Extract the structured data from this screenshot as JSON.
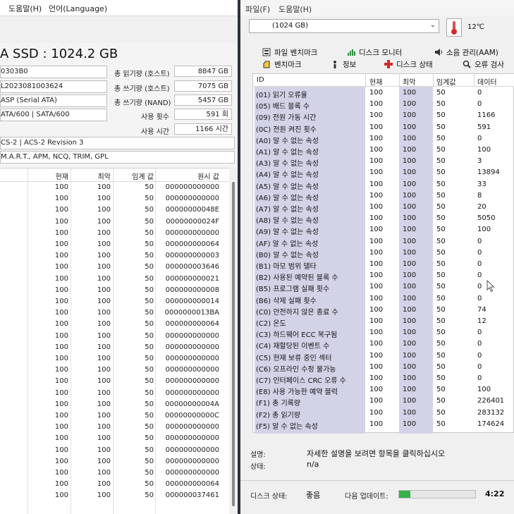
{
  "left": {
    "menu": [
      "도움말(H)",
      "언어(Language)"
    ],
    "title": "A SSD : 1024.2 GB",
    "fields": [
      {
        "value": "0303B0"
      },
      {
        "value": "L2023081003624"
      },
      {
        "value": "ASP (Serial ATA)"
      },
      {
        "value": "ATA/600 | SATA/600"
      }
    ],
    "stats": [
      {
        "label": "총 읽기량 (호스트)",
        "value": "8847 GB"
      },
      {
        "label": "총 쓰기량 (호스트)",
        "value": "7075 GB"
      },
      {
        "label": "총 쓰기량 (NAND)",
        "value": "5457 GB"
      },
      {
        "label": "사용 횟수",
        "value": "591 회"
      },
      {
        "label": "사용 시간",
        "value": "1166 시간"
      }
    ],
    "standard": "CS-2 | ACS-2 Revision 3",
    "features": "M.A.R.T., APM, NCQ, TRIM, GPL",
    "columns": [
      "현재",
      "최악",
      "임계 값",
      "원시 값"
    ],
    "rows": [
      [
        "100",
        "100",
        "50",
        "000000000000"
      ],
      [
        "100",
        "100",
        "50",
        "000000000000"
      ],
      [
        "100",
        "100",
        "50",
        "00000000048E"
      ],
      [
        "100",
        "100",
        "50",
        "00000000024F"
      ],
      [
        "100",
        "100",
        "50",
        "000000000000"
      ],
      [
        "100",
        "100",
        "50",
        "000000000064"
      ],
      [
        "100",
        "100",
        "50",
        "000000000003"
      ],
      [
        "100",
        "100",
        "50",
        "000000003646"
      ],
      [
        "100",
        "100",
        "50",
        "000000000021"
      ],
      [
        "100",
        "100",
        "50",
        "000000000008"
      ],
      [
        "100",
        "100",
        "50",
        "000000000014"
      ],
      [
        "100",
        "100",
        "50",
        "0000000013BA"
      ],
      [
        "100",
        "100",
        "50",
        "000000000064"
      ],
      [
        "100",
        "100",
        "50",
        "000000000000"
      ],
      [
        "100",
        "100",
        "50",
        "000000000000"
      ],
      [
        "100",
        "100",
        "50",
        "000000000000"
      ],
      [
        "100",
        "100",
        "50",
        "000000000000"
      ],
      [
        "100",
        "100",
        "50",
        "000000000000"
      ],
      [
        "100",
        "100",
        "50",
        "000000000000"
      ],
      [
        "100",
        "100",
        "50",
        "00000000004A"
      ],
      [
        "100",
        "100",
        "50",
        "00000000000C"
      ],
      [
        "100",
        "100",
        "50",
        "000000000000"
      ],
      [
        "100",
        "100",
        "50",
        "000000000000"
      ],
      [
        "100",
        "100",
        "50",
        "000000000000"
      ],
      [
        "100",
        "100",
        "50",
        "000000000000"
      ],
      [
        "100",
        "100",
        "50",
        "000000000000"
      ],
      [
        "100",
        "100",
        "50",
        "000000000064"
      ],
      [
        "100",
        "100",
        "50",
        "000000037461"
      ]
    ]
  },
  "right": {
    "menu": [
      "파일(F)",
      "도움말(H)"
    ],
    "drive": "(1024 GB)",
    "temperature": "12℃",
    "tabs": [
      {
        "label": "파일 벤치마크",
        "icon": "file-benchmark-icon"
      },
      {
        "label": "디스크 모니터",
        "icon": "disk-monitor-icon"
      },
      {
        "label": "소음 관리(AAM)",
        "icon": "speaker-icon"
      },
      {
        "label": "벤치마크",
        "icon": "benchmark-icon"
      },
      {
        "label": "정보",
        "icon": "info-icon"
      },
      {
        "label": "디스크 상태",
        "icon": "health-cross-icon"
      },
      {
        "label": "오류 검사",
        "icon": "magnifier-icon"
      }
    ],
    "columns": [
      "ID",
      "현재",
      "최악",
      "임계값",
      "데이터"
    ],
    "rows": [
      [
        "(01) 읽기 오류율",
        "100",
        "100",
        "50",
        "0"
      ],
      [
        "(05) 배드 블록 수",
        "100",
        "100",
        "50",
        "0"
      ],
      [
        "(09) 전원 가동 시간",
        "100",
        "100",
        "50",
        "1166"
      ],
      [
        "(0C) 전원 켜진 횟수",
        "100",
        "100",
        "50",
        "591"
      ],
      [
        "(A0) 알 수 없는 속성",
        "100",
        "100",
        "50",
        "0"
      ],
      [
        "(A1) 알 수 없는 속성",
        "100",
        "100",
        "50",
        "100"
      ],
      [
        "(A3) 알 수 없는 속성",
        "100",
        "100",
        "50",
        "3"
      ],
      [
        "(A4) 알 수 없는 속성",
        "100",
        "100",
        "50",
        "13894"
      ],
      [
        "(A5) 알 수 없는 속성",
        "100",
        "100",
        "50",
        "33"
      ],
      [
        "(A6) 알 수 없는 속성",
        "100",
        "100",
        "50",
        "8"
      ],
      [
        "(A7) 알 수 없는 속성",
        "100",
        "100",
        "50",
        "20"
      ],
      [
        "(A8) 알 수 없는 속성",
        "100",
        "100",
        "50",
        "5050"
      ],
      [
        "(A9) 알 수 없는 속성",
        "100",
        "100",
        "50",
        "100"
      ],
      [
        "(AF) 알 수 없는 속성",
        "100",
        "100",
        "50",
        "0"
      ],
      [
        "(B0) 알 수 없는 속성",
        "100",
        "100",
        "50",
        "0"
      ],
      [
        "(B1) 마모 범위 델타",
        "100",
        "100",
        "50",
        "0"
      ],
      [
        "(B2) 사용된 예약된 블록 수",
        "100",
        "100",
        "50",
        "0"
      ],
      [
        "(B5) 프로그램 실패 횟수",
        "100",
        "100",
        "50",
        "0"
      ],
      [
        "(B6) 삭제 실패 횟수",
        "100",
        "100",
        "50",
        "0"
      ],
      [
        "(C0) 안전하지 않은 종료 수",
        "100",
        "100",
        "50",
        "74"
      ],
      [
        "(C2) 온도",
        "100",
        "100",
        "50",
        "12"
      ],
      [
        "(C3) 하드웨어 ECC 복구됨",
        "100",
        "100",
        "50",
        "0"
      ],
      [
        "(C4) 재할당된 이벤트 수",
        "100",
        "100",
        "50",
        "0"
      ],
      [
        "(C5) 현재 보류 중인 섹터",
        "100",
        "100",
        "50",
        "0"
      ],
      [
        "(C6) 오프라인 수정 불가능",
        "100",
        "100",
        "50",
        "0"
      ],
      [
        "(C7) 인터페이스 CRC 오류 수",
        "100",
        "100",
        "50",
        "0"
      ],
      [
        "(E8) 사용 가능한 예약 블럭",
        "100",
        "100",
        "50",
        "100"
      ],
      [
        "(F1) 총 기록량",
        "100",
        "100",
        "50",
        "226401"
      ],
      [
        "(F2) 총 읽기량",
        "100",
        "100",
        "50",
        "283132"
      ],
      [
        "(F5) 알 수 없는 속성",
        "100",
        "100",
        "50",
        "174624"
      ]
    ],
    "description_label": "설명:",
    "description": "자세한 설명을 보려면 항목을 클릭하십시오",
    "state_label": "상태:",
    "state": "n/a",
    "disk_status_label": "디스크 상태:",
    "disk_status": "좋음",
    "next_update_label": "다음 업데이트:",
    "update_progress": 0.15,
    "time_left": "4:22",
    "accent": "#35b04a"
  }
}
